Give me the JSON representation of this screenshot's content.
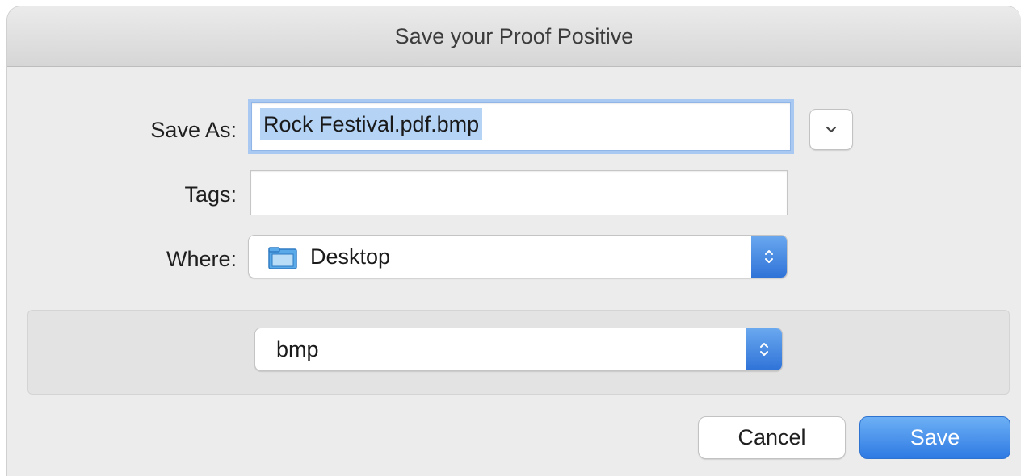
{
  "dialog": {
    "title": "Save your Proof Positive"
  },
  "form": {
    "save_as_label": "Save As:",
    "save_as_value": "Rock Festival.pdf.bmp",
    "tags_label": "Tags:",
    "tags_value": "",
    "where_label": "Where:",
    "where_value": "Desktop",
    "where_icon": "folder-icon"
  },
  "accessory": {
    "format_value": "bmp"
  },
  "buttons": {
    "cancel_label": "Cancel",
    "save_label": "Save"
  },
  "colors": {
    "accent": "#3a86e8",
    "selection": "#b4d3f5",
    "focus_ring": "#a9c9f2"
  }
}
